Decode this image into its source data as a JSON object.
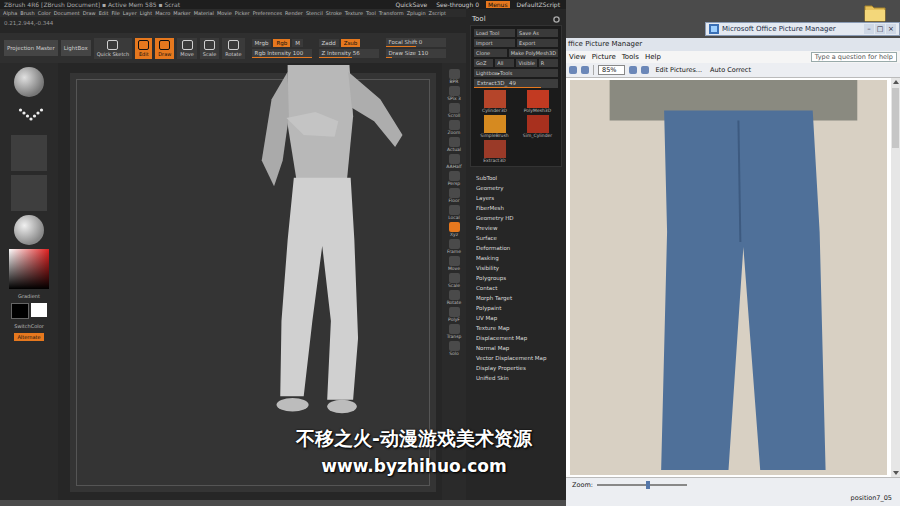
{
  "zbrush": {
    "title": "ZBrush 4R6 [ZBrush Document] ▪ Active Mem 585 ▪ Scrat",
    "title_buttons": [
      {
        "label": "QuickSave",
        "selected": false
      },
      {
        "label": "See-through 0",
        "selected": false
      },
      {
        "label": "Menus",
        "selected": true
      },
      {
        "label": "DefaultZScript",
        "selected": false
      }
    ],
    "menu": [
      "Alpha",
      "Brush",
      "Color",
      "Document",
      "Draw",
      "Edit",
      "File",
      "Layer",
      "Light",
      "Macro",
      "Marker",
      "Material",
      "Movie",
      "Picker",
      "Preferences",
      "Render",
      "Stencil",
      "Stroke",
      "Texture",
      "Tool",
      "Transform",
      "Zplugin",
      "Zscript"
    ],
    "coords": "0.21,2.944,-0.344",
    "shelf_buttons": [
      "Projection Master",
      "LightBox"
    ],
    "modes": [
      {
        "label": "Quick Sketch",
        "selected": false
      },
      {
        "label": "Edit",
        "selected": true
      },
      {
        "label": "Draw",
        "selected": true
      },
      {
        "label": "Move",
        "selected": false
      },
      {
        "label": "Scale",
        "selected": false
      },
      {
        "label": "Rotate",
        "selected": false
      }
    ],
    "color_modes": [
      {
        "label": "Mrgb",
        "selected": false
      },
      {
        "label": "Rgb",
        "selected": true
      },
      {
        "label": "M",
        "selected": false
      }
    ],
    "z_modes": [
      {
        "label": "Zadd",
        "selected": false
      },
      {
        "label": "Zsub",
        "selected": true
      }
    ],
    "sliders": [
      {
        "label": "Rgb Intensity",
        "value": "100",
        "level": 1
      },
      {
        "label": "Z Intensity",
        "value": "56",
        "level": 0.56
      },
      {
        "label": "Focal Shift",
        "value": "0",
        "level": 0.5
      },
      {
        "label": "Draw Size",
        "value": "110",
        "level": 0.11
      }
    ],
    "left_shelf": {
      "gradient": "Gradient",
      "switch": "SwitchColor",
      "alternate": "Alternate"
    },
    "right_shelf": [
      {
        "label": "BPR",
        "selected": false
      },
      {
        "label": "SPix 3",
        "selected": false
      },
      {
        "label": "Scroll",
        "selected": false
      },
      {
        "label": "Zoom",
        "selected": false
      },
      {
        "label": "Actual",
        "selected": false
      },
      {
        "label": "AAHalf",
        "selected": false
      },
      {
        "label": "Persp",
        "selected": false
      },
      {
        "label": "Floor",
        "selected": false
      },
      {
        "label": "Local",
        "selected": false
      },
      {
        "label": "Xyz",
        "selected": true
      },
      {
        "label": "Frame",
        "selected": false
      },
      {
        "label": "Move",
        "selected": false
      },
      {
        "label": "Scale",
        "selected": false
      },
      {
        "label": "Rotate",
        "selected": false
      },
      {
        "label": "PolyF",
        "selected": false
      },
      {
        "label": "Transp",
        "selected": false
      },
      {
        "label": "Solo",
        "selected": false
      }
    ],
    "tool": {
      "title": "Tool",
      "button_rows": [
        [
          "Load Tool",
          "Save As"
        ],
        [
          "Import",
          "Export"
        ],
        [
          "Clone",
          "Make PolyMesh3D"
        ],
        [
          "GoZ",
          "All",
          "Visible",
          "R"
        ]
      ],
      "lightbox": "Lightbox▸Tools",
      "extract": {
        "label": "Extract3D_",
        "value": "49",
        "level": 0.8
      },
      "thumbnails": [
        "Cylinder3D",
        "PolyMesh3D",
        "SimpleBrush",
        "Sim_Cylinder",
        "Extract3D"
      ],
      "sections": [
        "SubTool",
        "Geometry",
        "Layers",
        "FiberMesh",
        "Geometry HD",
        "Preview",
        "Surface",
        "Deformation",
        "Masking",
        "Visibility",
        "Polygroups",
        "Contact",
        "Morph Target",
        "Polypaint",
        "UV Map",
        "Texture Map",
        "Displacement Map",
        "Normal Map",
        "Vector Displacement Map",
        "Display Properties",
        "Unified Skin"
      ]
    }
  },
  "picture_manager": {
    "taskbar_title": "Microsoft Office Picture Manager",
    "controls": [
      "–",
      "□",
      "×"
    ],
    "title": "ffice Picture Manager",
    "menu": [
      "View",
      "Picture",
      "Tools",
      "Help"
    ],
    "help_placeholder": "Type a question for help",
    "zoom": "85%",
    "edit_button": "Edit Pictures...",
    "auto_correct": "Auto Correct",
    "zoom_label": "Zoom:",
    "zoom_level": 0.55,
    "filename": "position7_05"
  },
  "watermark": {
    "title": "不移之火-动漫游戏美术资源",
    "url": "www.byzhihuo.com"
  }
}
